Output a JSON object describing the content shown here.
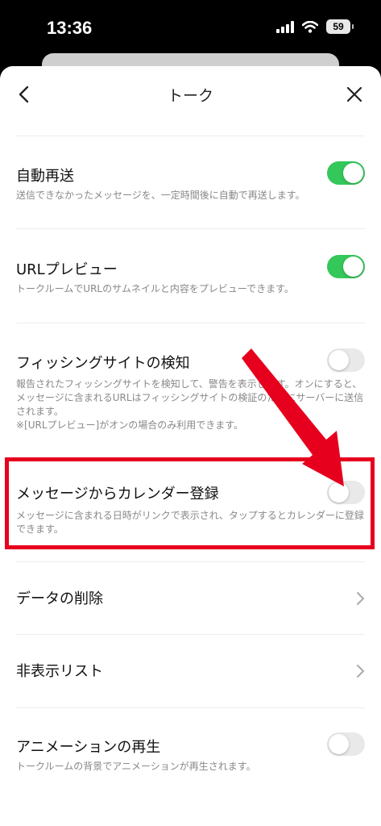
{
  "status_bar": {
    "time": "13:36",
    "battery": "59"
  },
  "nav": {
    "title": "トーク"
  },
  "settings": [
    {
      "title": "自動再送",
      "desc": "送信できなかったメッセージを、一定時間後に自動で再送します。",
      "toggle": "on"
    },
    {
      "title": "URLプレビュー",
      "desc": "トークルームでURLのサムネイルと内容をプレビューできます。",
      "toggle": "on"
    },
    {
      "title": "フィッシングサイトの検知",
      "desc1": "報告されたフィッシングサイトを検知して、警告を表示します。オンにすると、メッセージに含まれるURLはフィッシングサイトの検証のためにサーバーに送信されます。",
      "desc2": "※[URLプレビュー]がオンの場合のみ利用できます。",
      "toggle": "off"
    },
    {
      "title": "メッセージからカレンダー登録",
      "desc": "メッセージに含まれる日時がリンクで表示され、タップするとカレンダーに登録できます。",
      "toggle": "off"
    },
    {
      "title": "データの削除"
    },
    {
      "title": "非表示リスト"
    },
    {
      "title": "アニメーションの再生",
      "desc": "トークルームの背景でアニメーションが再生されます。",
      "toggle": "off"
    }
  ],
  "colors": {
    "toggle_on": "#34c759",
    "toggle_off": "#e9e9ea",
    "highlight": "#e6001e"
  },
  "icons": [
    "back-chevron-icon",
    "close-icon",
    "signal-icon",
    "wifi-icon",
    "battery-icon",
    "chevron-right-icon",
    "annotation-arrow"
  ]
}
